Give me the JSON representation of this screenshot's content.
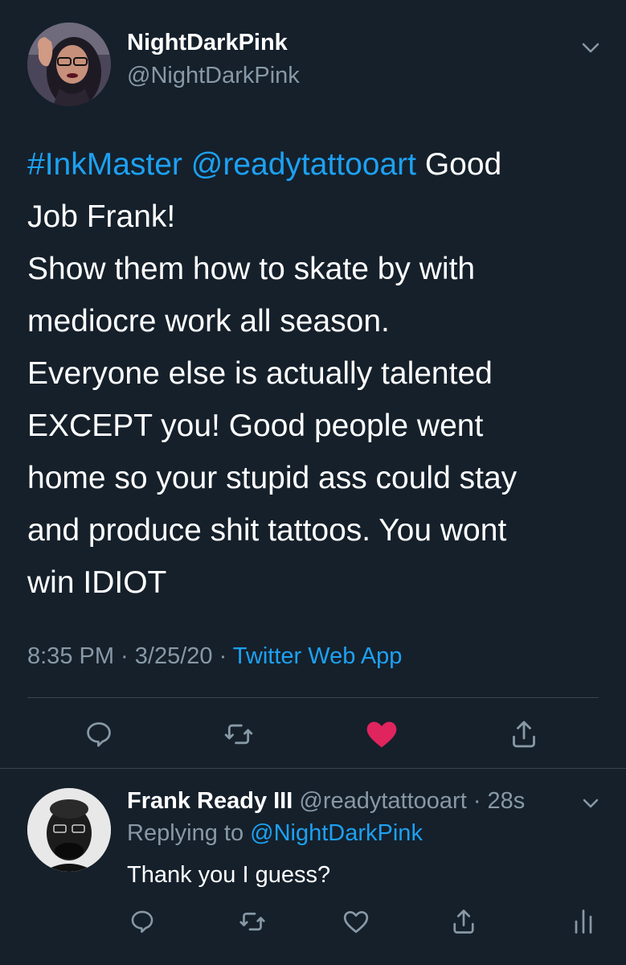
{
  "tweet": {
    "author_name": "NightDarkPink",
    "author_handle": "@NightDarkPink",
    "body": {
      "hashtag": "#InkMaster",
      "mention": "@readytattooart",
      "line1_rest": " Good",
      "line2": "Job Frank!",
      "line3": "Show them how to skate by with",
      "line4": "mediocre work all season.",
      "line5": "Everyone else is actually talented",
      "line6": "EXCEPT you! Good people went",
      "line7": "home so your stupid ass could stay",
      "line8": "and produce shit tattoos. You wont",
      "line9": "win IDIOT"
    },
    "time": "8:35 PM",
    "sep1": " · ",
    "date": "3/25/20",
    "sep2": " · ",
    "source": "Twitter Web App",
    "liked": true,
    "like_color": "#e0245e"
  },
  "reply": {
    "author_name": "Frank Ready III",
    "author_handle": "@readytattooart",
    "sep": " · ",
    "time": "28s",
    "replying_prefix": "Replying to ",
    "replying_to": "@NightDarkPink",
    "text": "Thank you I guess?"
  },
  "icons": {
    "reply": "reply-icon",
    "retweet": "retweet-icon",
    "like": "heart-icon",
    "share": "share-icon",
    "analytics": "analytics-icon",
    "caret": "chevron-down-icon"
  },
  "colors": {
    "background": "#15202b",
    "text": "#ffffff",
    "secondary": "#8899a6",
    "accent": "#1da1f2",
    "divider": "#38444d"
  }
}
